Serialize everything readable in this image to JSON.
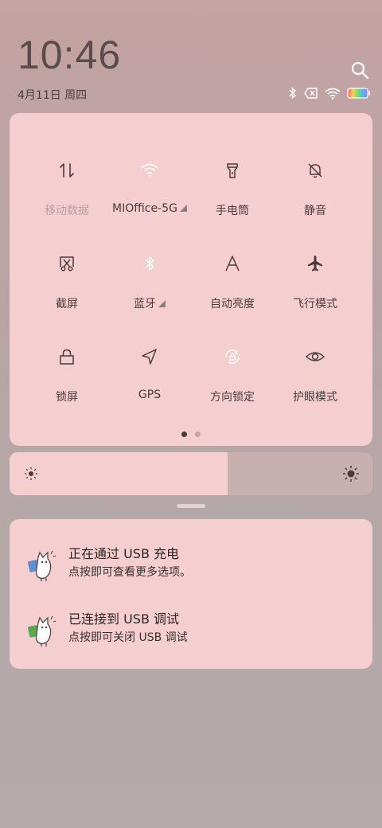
{
  "clock": {
    "time": "10:46",
    "date": "4月11日 周四"
  },
  "status_icons": [
    "bluetooth-icon",
    "sim-blocked-icon",
    "wifi-icon",
    "battery-icon"
  ],
  "quick_settings": [
    {
      "id": "mobile-data",
      "icon": "mobile-data-icon",
      "label": "移动数据",
      "active": false
    },
    {
      "id": "wifi",
      "icon": "wifi-icon",
      "label": "MIOffice-5G",
      "active": false,
      "expandable": true
    },
    {
      "id": "flashlight",
      "icon": "flashlight-icon",
      "label": "手电筒",
      "active": false
    },
    {
      "id": "silent",
      "icon": "bell-off-icon",
      "label": "静音",
      "active": false
    },
    {
      "id": "screenshot",
      "icon": "scissors-icon",
      "label": "截屏",
      "active": false
    },
    {
      "id": "bluetooth",
      "icon": "bluetooth-icon",
      "label": "蓝牙",
      "active": false,
      "expandable": true
    },
    {
      "id": "auto-brightness",
      "icon": "auto-brightness-icon",
      "label": "自动亮度",
      "active": false
    },
    {
      "id": "airplane",
      "icon": "airplane-icon",
      "label": "飞行模式",
      "active": false
    },
    {
      "id": "lock-screen",
      "icon": "lock-icon",
      "label": "锁屏",
      "active": false
    },
    {
      "id": "gps",
      "icon": "navigation-icon",
      "label": "GPS",
      "active": false
    },
    {
      "id": "rotation-lock",
      "icon": "rotation-lock-icon",
      "label": "方向锁定",
      "active": false
    },
    {
      "id": "eye-care",
      "icon": "eye-icon",
      "label": "护眼模式",
      "active": false
    }
  ],
  "pager": {
    "pages": 2,
    "current": 1
  },
  "brightness": {
    "level": 0.6
  },
  "notifications": [
    {
      "title": "正在通过 USB 充电",
      "subtitle": "点按即可查看更多选项。",
      "icon": "android-system-icon"
    },
    {
      "title": "已连接到 USB 调试",
      "subtitle": "点按即可关闭 USB 调试",
      "icon": "android-system-icon"
    }
  ],
  "colors": {
    "panel": "#f5cfcf",
    "icon": "#4a3b3b",
    "dim_icon": "#b8a0a0",
    "background": "#b9a4a5"
  }
}
